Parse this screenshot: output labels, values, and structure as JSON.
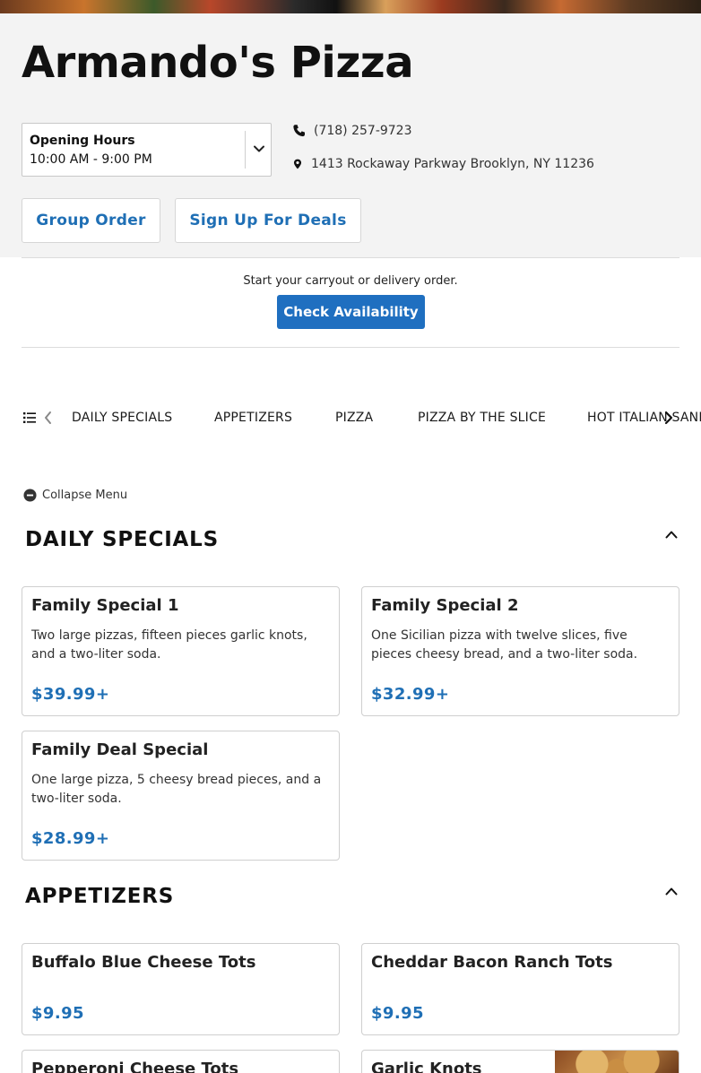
{
  "restaurant": {
    "name": "Armando's Pizza",
    "phone": "(718) 257-9723",
    "address": "1413 Rockaway Parkway Brooklyn, NY 11236"
  },
  "hours": {
    "label": "Opening Hours",
    "value": "10:00 AM - 9:00 PM"
  },
  "actions": {
    "group_order": "Group Order",
    "sign_up": "Sign Up For Deals"
  },
  "availability": {
    "prompt": "Start your carryout or delivery order.",
    "button": "Check Availability"
  },
  "category_nav": {
    "items": [
      "DAILY SPECIALS",
      "APPETIZERS",
      "PIZZA",
      "PIZZA BY THE SLICE",
      "HOT ITALIAN SANDWICHES"
    ]
  },
  "menu": {
    "collapse_label": "Collapse Menu",
    "sections": [
      {
        "title": "DAILY SPECIALS",
        "items": [
          {
            "name": "Family Special 1",
            "description": "Two large pizzas, fifteen pieces garlic knots, and a two-liter soda.",
            "price": "$39.99+"
          },
          {
            "name": "Family Special 2",
            "description": "One Sicilian pizza with twelve slices, five pieces cheesy bread, and a two-liter soda.",
            "price": "$32.99+"
          },
          {
            "name": "Family Deal Special",
            "description": "One large pizza, 5 cheesy bread pieces, and a two-liter soda.",
            "price": "$28.99+"
          }
        ]
      },
      {
        "title": "APPETIZERS",
        "items": [
          {
            "name": "Buffalo Blue Cheese Tots",
            "price": "$9.95"
          },
          {
            "name": "Cheddar Bacon Ranch Tots",
            "price": "$9.95"
          },
          {
            "name": "Pepperoni Cheese Tots"
          },
          {
            "name": "Garlic Knots"
          }
        ]
      }
    ]
  },
  "colors": {
    "accent": "#1f6fb5",
    "button_primary": "#1f6fc0",
    "header_bg": "#f3f3f3"
  },
  "icons": [
    "phone-icon",
    "map-pin-icon",
    "chevron-down-icon",
    "list-icon",
    "chevron-left-icon",
    "chevron-right-icon",
    "minus-circle-icon",
    "chevron-up-icon"
  ]
}
